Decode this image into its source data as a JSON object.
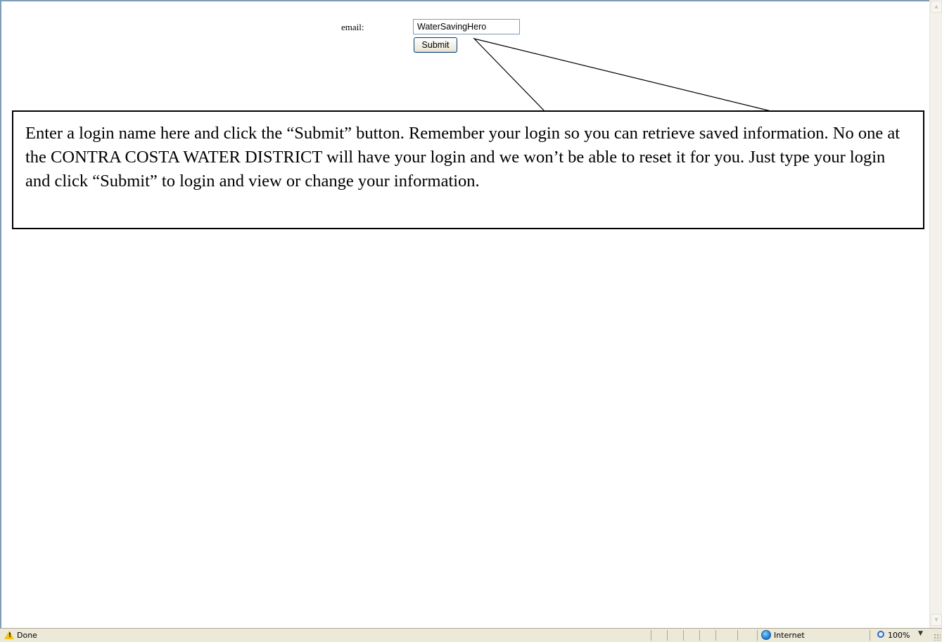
{
  "form": {
    "email_label": "email:",
    "email_value": "WaterSavingHero",
    "submit_label": "Submit"
  },
  "callout": {
    "text": "Enter a login name here and click the “Submit” button.  Remember your login so you can retrieve saved information.  No one at the CONTRA COSTA WATER DISTRICT will have your login and we won’t be able to reset it for you.  Just type your login and click “Submit” to login and view or change your information."
  },
  "statusbar": {
    "status_text": "Done",
    "zone_text": "Internet",
    "zoom_text": "100%"
  },
  "icons": {
    "warning": "warning-icon",
    "globe": "globe-icon",
    "zoom": "zoom-icon",
    "scroll_up": "scroll-up-arrow-icon",
    "scroll_down": "scroll-down-arrow-icon"
  }
}
